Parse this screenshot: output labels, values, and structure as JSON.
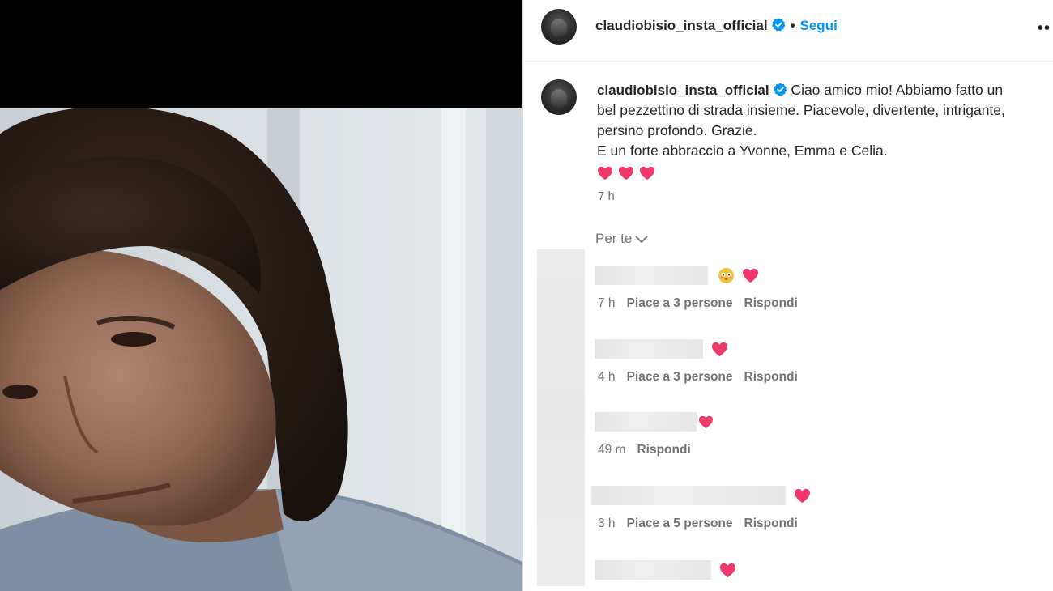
{
  "post": {
    "username": "claudiobisio_insta_official",
    "follow_label": "Segui",
    "separator": "•",
    "more": "••"
  },
  "caption": {
    "username": "claudiobisio_insta_official",
    "lines": [
      " Ciao amico mio! Abbiamo fatto un",
      "bel pezzettino di strada insieme. Piacevole, divertente, intrigante,",
      "persino profondo. Grazie.",
      "E un forte abbraccio a Yvonne, Emma e Celia."
    ],
    "time": "7 h"
  },
  "comments_sort": "Per te",
  "comments": [
    {
      "emojis": [
        "flushed-face-icon",
        "heart-icon"
      ],
      "time": "7 h",
      "likes": "Piace a 3 persone",
      "reply": "Rispondi"
    },
    {
      "emojis": [
        "heart-icon"
      ],
      "time": "4 h",
      "likes": "Piace a 3 persone",
      "reply": "Rispondi"
    },
    {
      "emojis": [
        "heart-icon"
      ],
      "time": "49 m",
      "likes": "",
      "reply": "Rispondi"
    },
    {
      "emojis": [
        "heart-icon"
      ],
      "time": "3 h",
      "likes": "Piace a 5 persone",
      "reply": "Rispondi"
    },
    {
      "emojis": [
        "heart-icon"
      ],
      "time": "",
      "likes": "",
      "reply": ""
    }
  ],
  "colors": {
    "follow": "#0095f6",
    "verified": "#0095f6",
    "heart": "#f0386b",
    "muted": "#737373",
    "text": "#262626"
  }
}
